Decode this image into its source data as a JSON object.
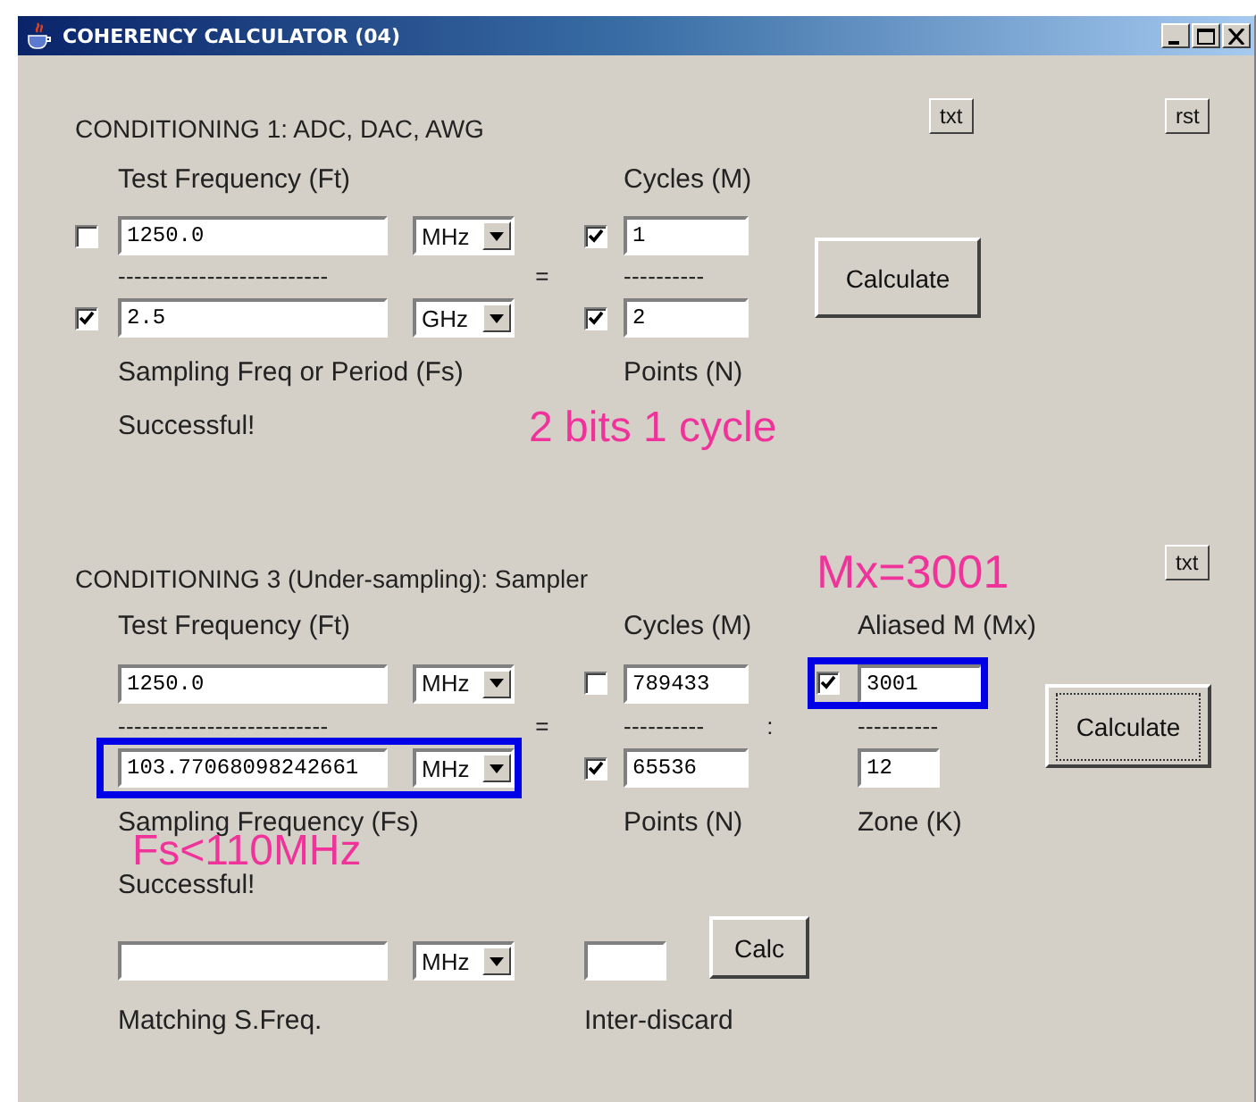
{
  "window": {
    "title": "COHERENCY CALCULATOR (04)"
  },
  "conditioning_1": {
    "heading": "CONDITIONING 1: ADC, DAC, AWG",
    "txt_button": "txt",
    "rst_button": "rst",
    "test_frequency": {
      "label": "Test Frequency (Ft)",
      "checked": false,
      "value": "1250.0",
      "unit": "MHz"
    },
    "long_divider": "--------------------------",
    "equals": "=",
    "short_divider": "----------",
    "sampling": {
      "label": "Sampling Freq or Period (Fs)",
      "checked": true,
      "value": "2.5",
      "unit": "GHz"
    },
    "cycles": {
      "label": "Cycles (M)",
      "checked": true,
      "value": "1"
    },
    "points": {
      "label": "Points (N)",
      "checked": true,
      "value": "2"
    },
    "calculate_button": "Calculate",
    "status": "Successful!"
  },
  "conditioning_3": {
    "heading": "CONDITIONING 3 (Under-sampling): Sampler",
    "txt_button": "txt",
    "test_frequency": {
      "label": "Test Frequency (Ft)",
      "value": "1250.0",
      "unit": "MHz"
    },
    "long_divider": "--------------------------",
    "equals": "=",
    "short_divider": "----------",
    "colon": ":",
    "aliased_divider": "----------",
    "sampling": {
      "label": "Sampling Frequency (Fs)",
      "value": "103.77068098242661",
      "unit": "MHz"
    },
    "cycles": {
      "label": "Cycles (M)",
      "checked": false,
      "value": "789433"
    },
    "points": {
      "label": "Points (N)",
      "checked": true,
      "value": "65536"
    },
    "aliased": {
      "label": "Aliased M (Mx)",
      "checked": true,
      "value": "3001"
    },
    "zone": {
      "label": "Zone (K)",
      "value": "12"
    },
    "calculate_button": "Calculate",
    "status": "Successful!",
    "matching": {
      "label": "Matching S.Freq.",
      "unit": "MHz"
    },
    "inter_discard": {
      "label": "Inter-discard"
    },
    "calc_button": "Calc"
  },
  "annotations": [
    {
      "text": "2 bits 1 cycle"
    },
    {
      "text": "Mx=3001"
    },
    {
      "text": "Fs<110MHz"
    }
  ]
}
